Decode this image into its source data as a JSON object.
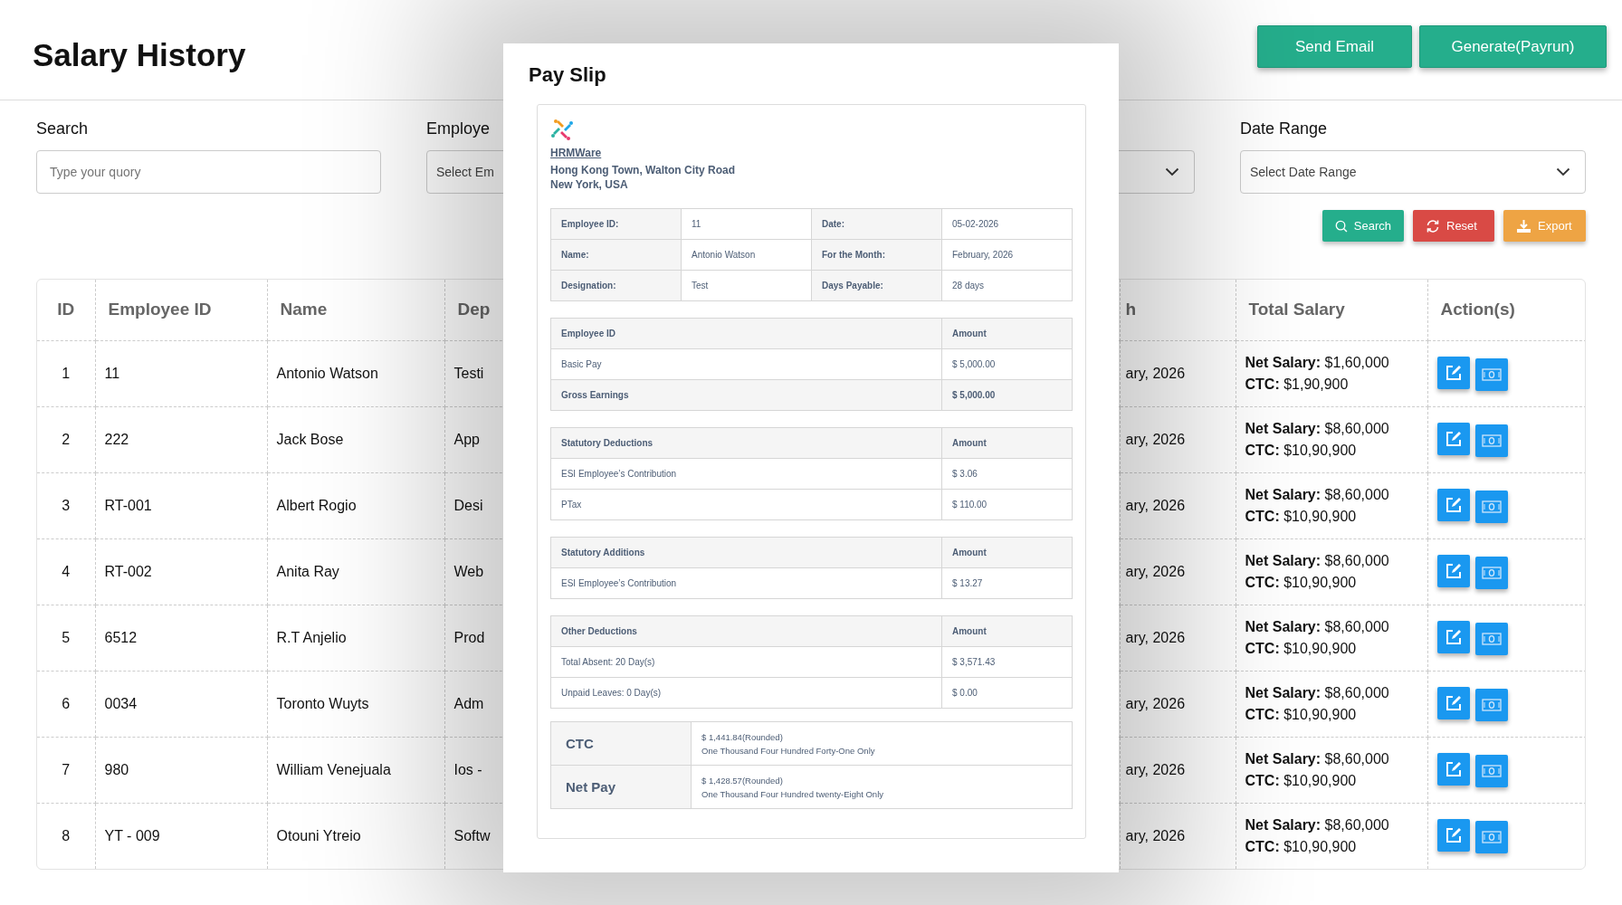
{
  "page": {
    "title": "Salary History",
    "header_buttons": [
      "Send Email",
      "Generate(Payrun)"
    ]
  },
  "filters": [
    {
      "kind": "input",
      "label": "Search",
      "placeholder": "Type your quory"
    },
    {
      "kind": "select",
      "label": "Employe",
      "placeholder": "Select Em"
    },
    {
      "kind": "select",
      "label": "Date Range",
      "placeholder": "Select Date Range"
    }
  ],
  "filter_buttons": [
    {
      "kind": "search",
      "label": "Search"
    },
    {
      "kind": "reset",
      "label": "Reset"
    },
    {
      "kind": "export",
      "label": "Export"
    }
  ],
  "table": {
    "columns": [
      "ID",
      "Employee ID",
      "Name",
      "Dep",
      "h",
      "Total Salary",
      "Action(s)"
    ],
    "rows": [
      {
        "id": "1",
        "employee_id": "11",
        "name": "Antonio Watson",
        "column_4": "Testi",
        "column_5": "ary, 2026",
        "net_salary_label": "Net Salary:",
        "net_salary": "$1,60,000",
        "ctc_label": "CTC:",
        "ctc": "$1,90,900"
      },
      {
        "id": "2",
        "employee_id": "222",
        "name": "Jack Bose",
        "column_4": "App",
        "column_5": "ary, 2026",
        "net_salary_label": "Net Salary:",
        "net_salary": "$8,60,000",
        "ctc_label": "CTC:",
        "ctc": "$10,90,900"
      },
      {
        "id": "3",
        "employee_id": "RT-001",
        "name": "Albert Rogio",
        "column_4": "Desi",
        "column_5": "ary, 2026",
        "net_salary_label": "Net Salary:",
        "net_salary": "$8,60,000",
        "ctc_label": "CTC:",
        "ctc": "$10,90,900"
      },
      {
        "id": "4",
        "employee_id": "RT-002",
        "name": "Anita Ray",
        "column_4": "Web",
        "column_5": "ary, 2026",
        "net_salary_label": "Net Salary:",
        "net_salary": "$8,60,000",
        "ctc_label": "CTC:",
        "ctc": "$10,90,900"
      },
      {
        "id": "5",
        "employee_id": "6512",
        "name": "R.T Anjelio",
        "column_4": "Prod",
        "column_5": "ary, 2026",
        "net_salary_label": "Net Salary:",
        "net_salary": "$8,60,000",
        "ctc_label": "CTC:",
        "ctc": "$10,90,900"
      },
      {
        "id": "6",
        "employee_id": "0034",
        "name": "Toronto Wuyts",
        "column_4": "Adm",
        "column_5": "ary, 2026",
        "net_salary_label": "Net Salary:",
        "net_salary": "$8,60,000",
        "ctc_label": "CTC:",
        "ctc": "$10,90,900"
      },
      {
        "id": "7",
        "employee_id": "980",
        "name": "William Venejuala",
        "column_4": "Ios -",
        "column_5": "ary, 2026",
        "net_salary_label": "Net Salary:",
        "net_salary": "$8,60,000",
        "ctc_label": "CTC:",
        "ctc": "$10,90,900"
      },
      {
        "id": "8",
        "employee_id": "YT - 009",
        "name": "Otouni Ytreio",
        "column_4": "Softw",
        "column_5": "ary, 2026",
        "net_salary_label": "Net Salary:",
        "net_salary": "$8,60,000",
        "ctc_label": "CTC:",
        "ctc": "$10,90,900"
      }
    ]
  },
  "payslip": {
    "title": "Pay Slip",
    "company": {
      "name": "HRMWare",
      "address": [
        "Hong Kong Town, Walton City Road",
        "New York, USA"
      ]
    },
    "info": [
      {
        "label": "Employee ID:",
        "value": "11"
      },
      {
        "label": "Date:",
        "value": "05-02-2026"
      },
      {
        "label": "Name:",
        "value": "Antonio Watson"
      },
      {
        "label": "For the Month:",
        "value": "February, 2026"
      },
      {
        "label": "Designation:",
        "value": "Test"
      },
      {
        "label": "Days Payable:",
        "value": "28 days"
      }
    ],
    "sections": [
      {
        "header": [
          "Employee ID",
          "Amount"
        ],
        "rows": [
          {
            "kind": "item",
            "label": "Basic Pay",
            "amount": "$ 5,000.00"
          },
          {
            "kind": "total",
            "label": "Gross Earnings",
            "amount": "$ 5,000.00"
          }
        ]
      },
      {
        "header": [
          "Statutory Deductions",
          "Amount"
        ],
        "rows": [
          {
            "kind": "item",
            "label": "ESI Employee’s Contribution",
            "amount": "$ 3.06"
          },
          {
            "kind": "item",
            "label": "PTax",
            "amount": "$ 110.00"
          }
        ]
      },
      {
        "header": [
          "Statutory Additions",
          "Amount"
        ],
        "rows": [
          {
            "kind": "item",
            "label": "ESI Employee’s Contribution",
            "amount": "$ 13.27"
          }
        ]
      },
      {
        "header": [
          "Other Deductions",
          "Amount"
        ],
        "rows": [
          {
            "kind": "item",
            "label": "Total Absent: 20 Day(s)",
            "amount": "$ 3,571.43"
          },
          {
            "kind": "item",
            "label": "Unpaid Leaves: 0 Day(s)",
            "amount": "$ 0.00"
          }
        ]
      }
    ],
    "summary": [
      {
        "label": "CTC",
        "amount": "$ 1,441.84(Rounded)",
        "words": "One Thousand Four Hundred Forty-One Only"
      },
      {
        "label": "Net Pay",
        "amount": "$ 1,428.57(Rounded)",
        "words": "One Thousand Four Hundred twenty-Eight Only"
      }
    ]
  }
}
